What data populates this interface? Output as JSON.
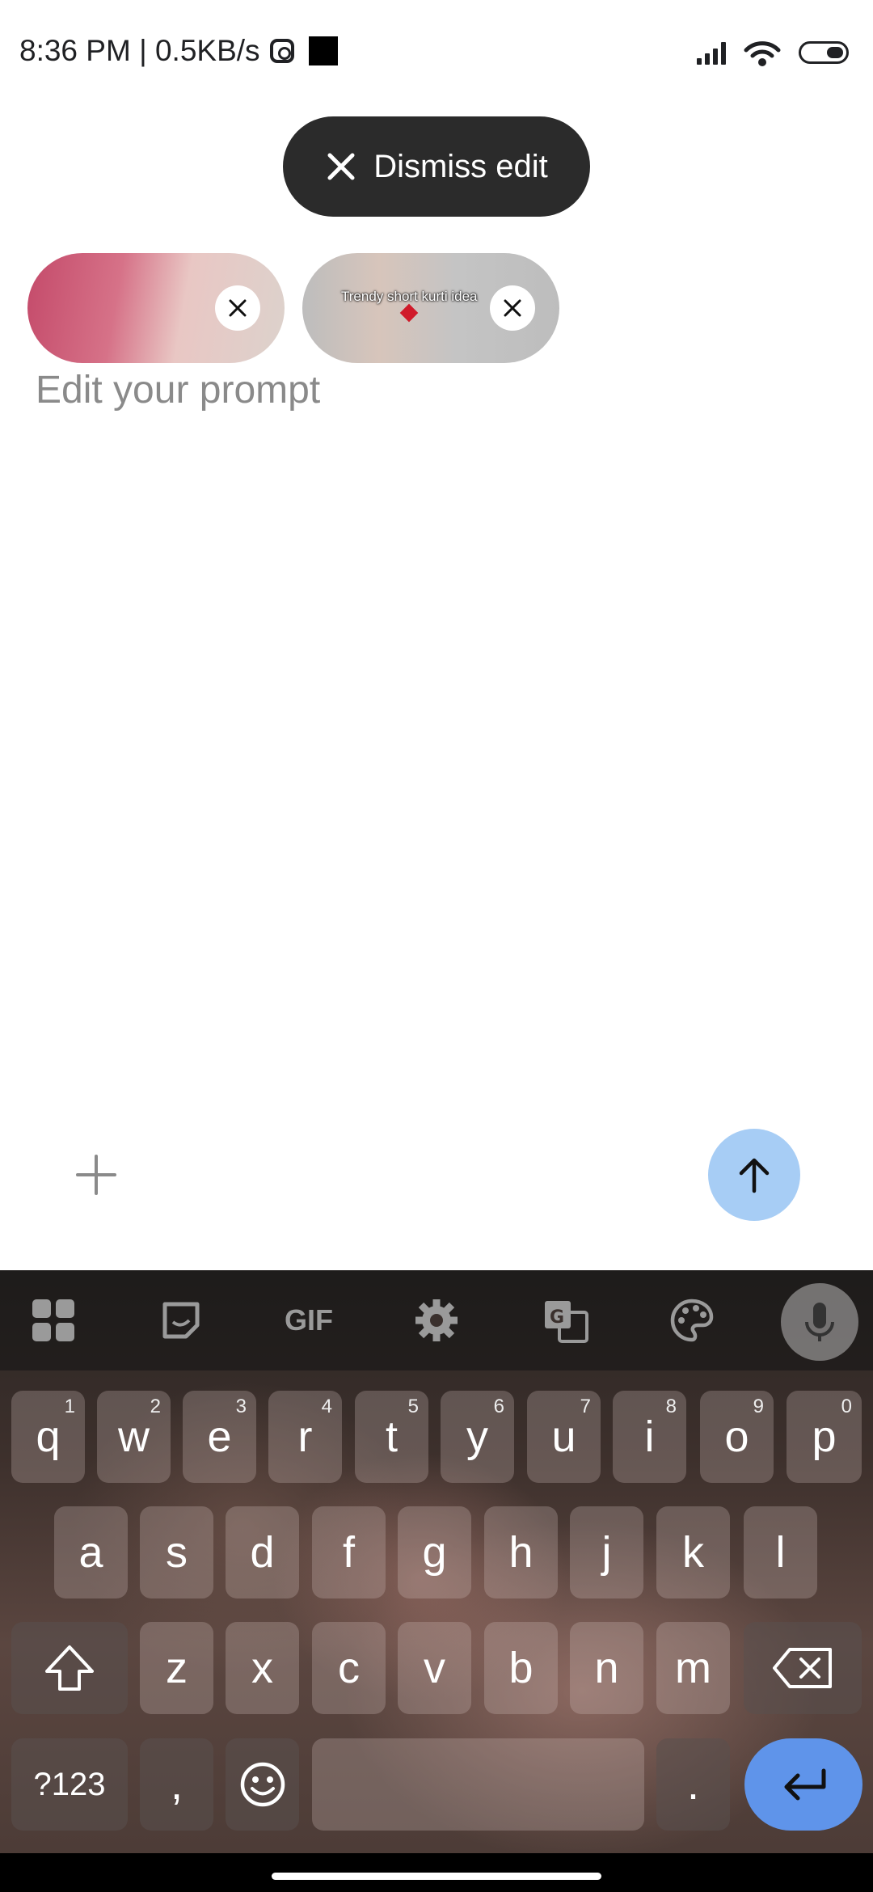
{
  "status": {
    "time_speed": "8:36 PM | 0.5KB/s"
  },
  "dismiss_label": "Dismiss edit",
  "attachments": [
    {
      "caption": ""
    },
    {
      "caption": "Trendy short kurti idea"
    }
  ],
  "prompt_placeholder": "Edit your prompt",
  "keyboard": {
    "toolbar": {
      "gif": "GIF"
    },
    "row1": [
      {
        "letter": "q",
        "hint": "1"
      },
      {
        "letter": "w",
        "hint": "2"
      },
      {
        "letter": "e",
        "hint": "3"
      },
      {
        "letter": "r",
        "hint": "4"
      },
      {
        "letter": "t",
        "hint": "5"
      },
      {
        "letter": "y",
        "hint": "6"
      },
      {
        "letter": "u",
        "hint": "7"
      },
      {
        "letter": "i",
        "hint": "8"
      },
      {
        "letter": "o",
        "hint": "9"
      },
      {
        "letter": "p",
        "hint": "0"
      }
    ],
    "row2": [
      "a",
      "s",
      "d",
      "f",
      "g",
      "h",
      "j",
      "k",
      "l"
    ],
    "row3": [
      "z",
      "x",
      "c",
      "v",
      "b",
      "n",
      "m"
    ],
    "row4": {
      "symbols": "?123",
      "comma": ",",
      "period": "."
    }
  },
  "colors": {
    "send_button": "#a7cdf5",
    "enter_key": "#5f94ea",
    "dismiss_chip": "#2b2b2b"
  }
}
